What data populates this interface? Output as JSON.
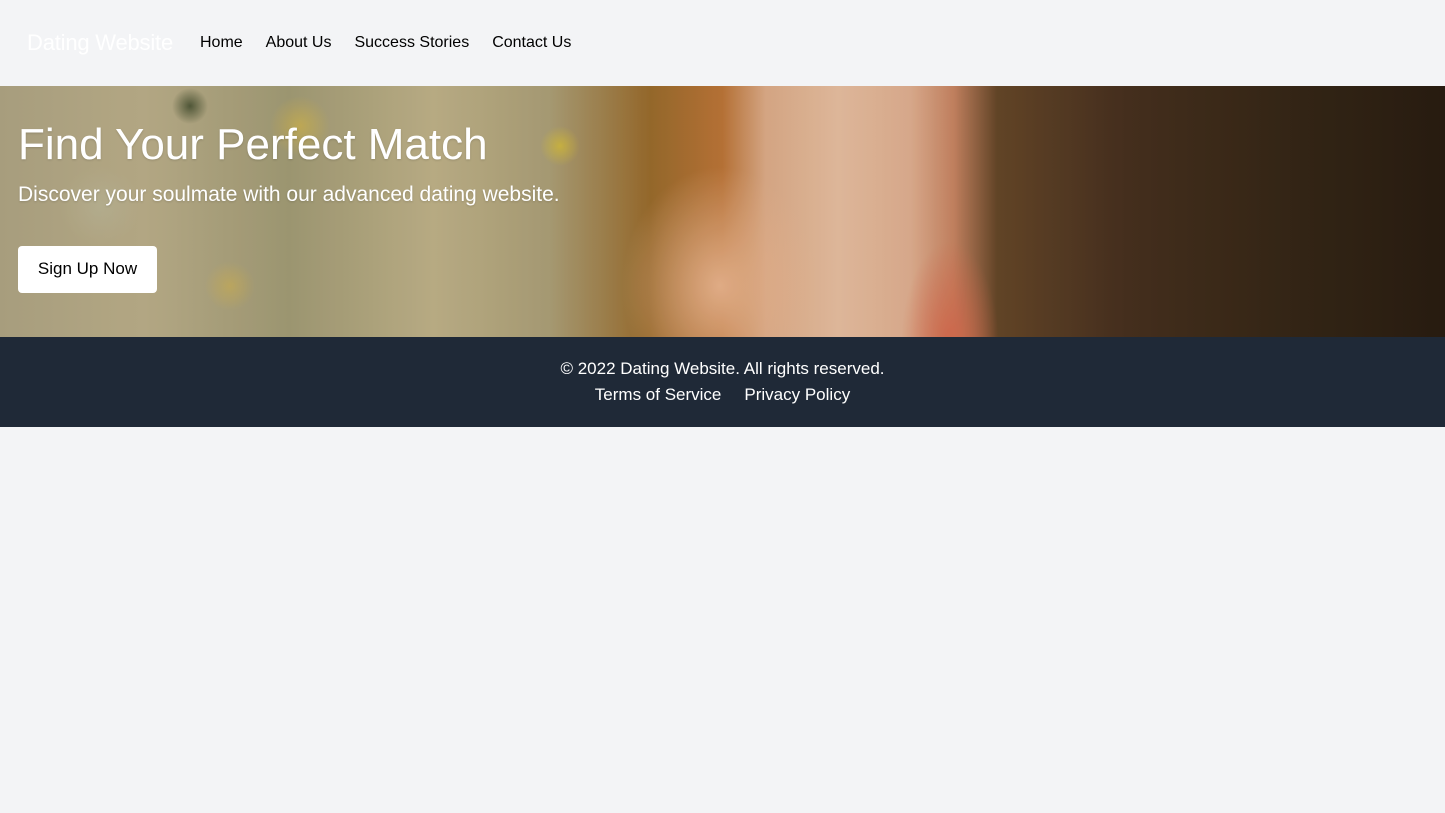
{
  "navbar": {
    "brand": "Dating Website",
    "links": [
      {
        "label": "Home"
      },
      {
        "label": "About Us"
      },
      {
        "label": "Success Stories"
      },
      {
        "label": "Contact Us"
      }
    ]
  },
  "hero": {
    "title": "Find Your Perfect Match",
    "subtitle": "Discover your soulmate with our advanced dating website.",
    "cta_label": "Sign Up Now",
    "image_alt": "couple-embracing-photo"
  },
  "footer": {
    "copyright": "© 2022 Dating Website. All rights reserved.",
    "links": [
      {
        "label": "Terms of Service"
      },
      {
        "label": "Privacy Policy"
      }
    ]
  },
  "colors": {
    "page_bg": "#f3f4f6",
    "footer_bg": "#1f2937",
    "text_light": "#ffffff",
    "text_dark": "#000000"
  }
}
